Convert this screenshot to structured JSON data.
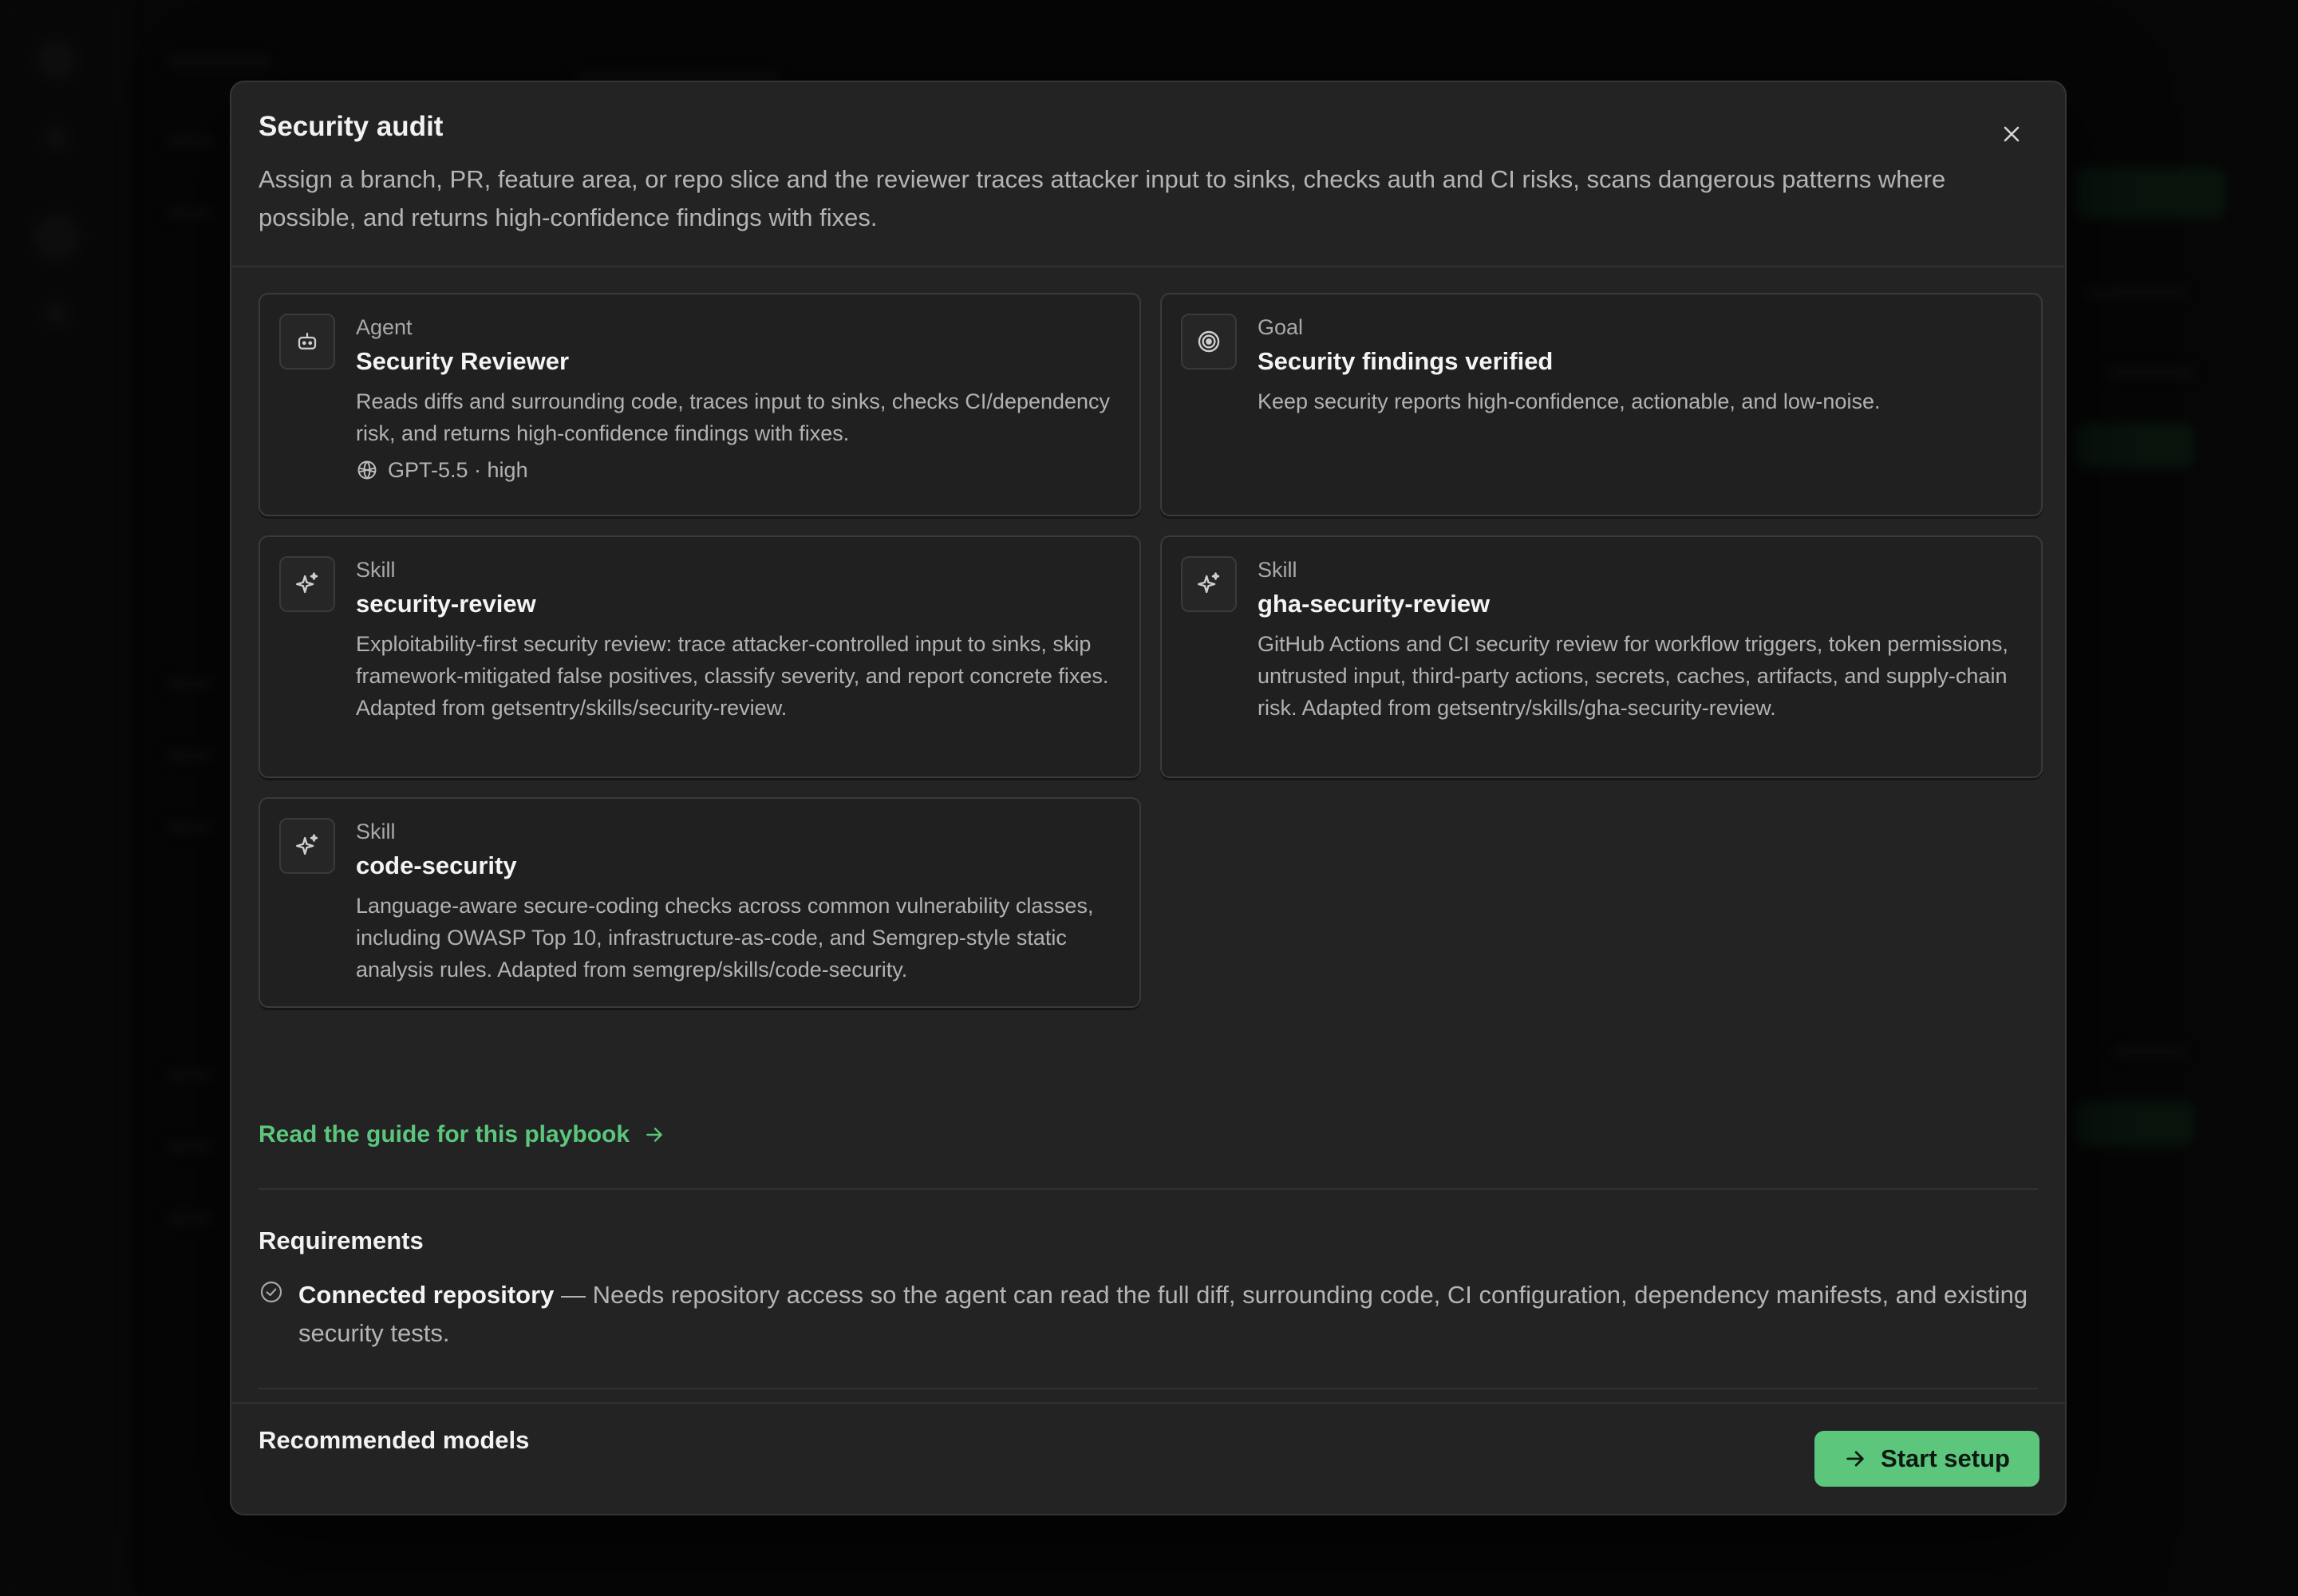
{
  "colors": {
    "accent": "#5cc67c",
    "modal_bg": "#232323",
    "card_bg": "#202020",
    "backdrop": "#0b0b0b"
  },
  "modal": {
    "title": "Security audit",
    "description": "Assign a branch, PR, feature area, or repo slice and the reviewer traces attacker input to sinks, checks auth and CI risks, scans dangerous patterns where possible, and returns high-confidence findings with fixes.",
    "close_icon": "close-icon"
  },
  "cards": [
    {
      "kind": "Agent",
      "name": "Security Reviewer",
      "description": "Reads diffs and surrounding code, traces input to sinks, checks CI/dependency risk, and returns high-confidence findings with fixes.",
      "meta": "GPT-5.5 · high",
      "icon": "robot-icon",
      "meta_icon": "model-icon"
    },
    {
      "kind": "Goal",
      "name": "Security findings verified",
      "description": "Keep security reports high-confidence, actionable, and low-noise.",
      "icon": "target-icon"
    },
    {
      "kind": "Skill",
      "name": "security-review",
      "description": "Exploitability-first security review: trace attacker-controlled input to sinks, skip framework-mitigated false positives, classify severity, and report concrete fixes. Adapted from getsentry/skills/security-review.",
      "icon": "sparkle-icon"
    },
    {
      "kind": "Skill",
      "name": "gha-security-review",
      "description": "GitHub Actions and CI security review for workflow triggers, token permissions, untrusted input, third-party actions, secrets, caches, artifacts, and supply-chain risk. Adapted from getsentry/skills/gha-security-review.",
      "icon": "sparkle-icon"
    },
    {
      "kind": "Skill",
      "name": "code-security",
      "description": "Language-aware secure-coding checks across common vulnerability classes, including OWASP Top 10, infrastructure-as-code, and Semgrep-style static analysis rules. Adapted from semgrep/skills/code-security.",
      "icon": "sparkle-icon"
    }
  ],
  "guide_link": {
    "label": "Read the guide for this playbook",
    "icon": "arrow-right-icon"
  },
  "requirements": {
    "title": "Requirements",
    "items": [
      {
        "name": "Connected repository",
        "separator": " — ",
        "description": "Needs repository access so the agent can read the full diff, surrounding code, CI configuration, dependency manifests, and existing security tests.",
        "icon": "check-circle-icon"
      }
    ]
  },
  "recommended_models": {
    "title": "Recommended models"
  },
  "footer": {
    "start_label": "Start setup",
    "start_icon": "arrow-right-icon"
  }
}
